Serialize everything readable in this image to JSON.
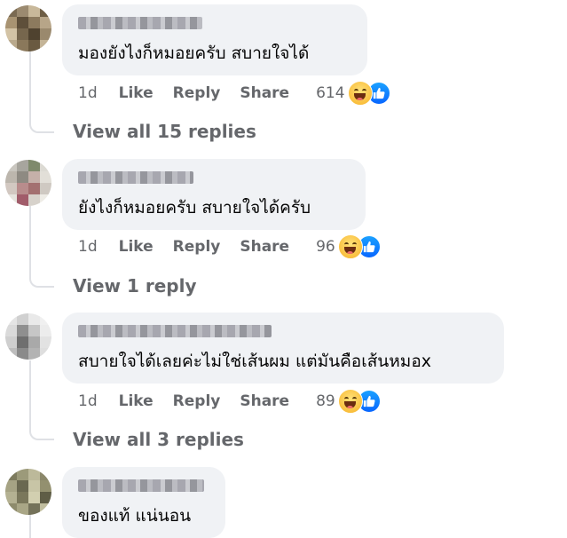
{
  "comments": [
    {
      "text": "มองยังไงก็หมอยครับ สบายใจได้",
      "time": "1d",
      "like_label": "Like",
      "reply_label": "Reply",
      "share_label": "Share",
      "reaction_count": "614",
      "reactions": [
        "haha-icon",
        "like-icon"
      ],
      "view_replies": "View all 15 replies"
    },
    {
      "text": "ยังไงก็หมอยครับ สบายใจได้ครับ",
      "time": "1d",
      "like_label": "Like",
      "reply_label": "Reply",
      "share_label": "Share",
      "reaction_count": "96",
      "reactions": [
        "haha-icon",
        "like-icon"
      ],
      "view_replies": "View 1 reply"
    },
    {
      "text": "สบายใจได้เลยค่ะไม่ใช่เส้นผม แต่มันคือเส้นหมอx",
      "time": "1d",
      "like_label": "Like",
      "reply_label": "Reply",
      "share_label": "Share",
      "reaction_count": "89",
      "reactions": [
        "haha-icon",
        "like-icon"
      ],
      "view_replies": "View all 3 replies"
    },
    {
      "text": "ของแท้ แน่นอน"
    }
  ],
  "colors": {
    "bubble": "#f0f2f5",
    "text": "#050505",
    "secondary": "#65676b",
    "like_blue": "#0866ff",
    "haha_yellow": "#f7b126",
    "thread_line": "#dfe1e5"
  }
}
